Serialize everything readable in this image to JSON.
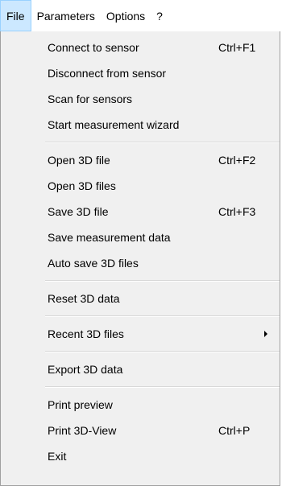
{
  "menubar": {
    "items": [
      {
        "label": "File"
      },
      {
        "label": "Parameters"
      },
      {
        "label": "Options"
      },
      {
        "label": "?"
      }
    ]
  },
  "file_menu": {
    "groups": [
      [
        {
          "label": "Connect to sensor",
          "shortcut": "Ctrl+F1"
        },
        {
          "label": "Disconnect from sensor"
        },
        {
          "label": "Scan for sensors"
        },
        {
          "label": "Start measurement wizard"
        }
      ],
      [
        {
          "label": "Open 3D file",
          "shortcut": "Ctrl+F2"
        },
        {
          "label": "Open 3D files"
        },
        {
          "label": "Save 3D file",
          "shortcut": "Ctrl+F3"
        },
        {
          "label": "Save measurement data"
        },
        {
          "label": "Auto save 3D files"
        }
      ],
      [
        {
          "label": "Reset 3D data"
        }
      ],
      [
        {
          "label": "Recent 3D files",
          "submenu_icon": "chevron-right-icon"
        }
      ],
      [
        {
          "label": "Export 3D data"
        }
      ],
      [
        {
          "label": "Print preview"
        },
        {
          "label": "Print 3D-View",
          "shortcut": "Ctrl+P"
        },
        {
          "label": "Exit"
        }
      ]
    ]
  },
  "colors": {
    "open_menu_highlight": "#cce8ff",
    "open_menu_border": "#99d1ff",
    "menu_background": "#f0f0f0"
  }
}
